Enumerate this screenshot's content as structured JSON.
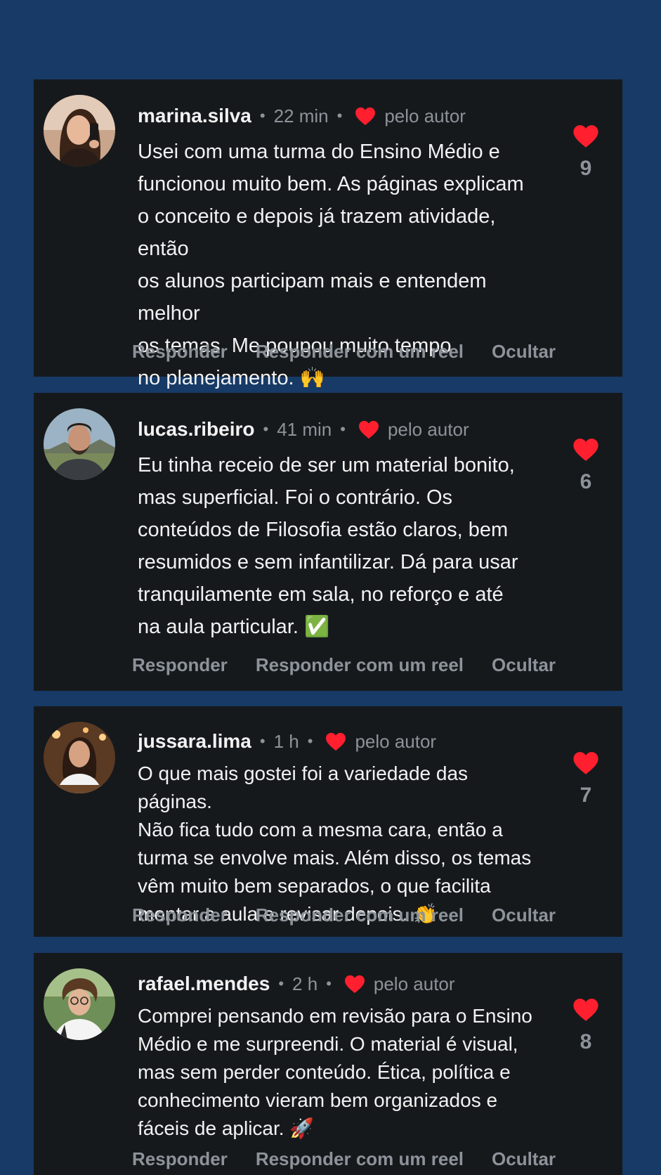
{
  "colors": {
    "background": "#173a66",
    "card": "#16191c",
    "heart": "#ff1f2e",
    "muted": "#8d939a",
    "text": "#f2f2f2"
  },
  "icons": {
    "author_like": "heart-icon",
    "like": "heart-icon"
  },
  "separator": "•",
  "comments": [
    {
      "username": "marina.silva",
      "time": "22 min",
      "liked_by_author": "pelo autor",
      "text": "Usei com uma turma do Ensino Médio e\nfuncionou muito bem. As páginas explicam\no conceito e depois já trazem atividade, então\nos alunos participam mais e entendem melhor\nos temas. Me poupou muito tempo\nno planejamento. 🙌",
      "likes": "9",
      "actions": [
        "Responder",
        "Responder com um reel",
        "Ocultar"
      ]
    },
    {
      "username": "lucas.ribeiro",
      "time": "41 min",
      "liked_by_author": "pelo autor",
      "text": "Eu tinha receio de ser um material bonito,\nmas superficial. Foi o contrário. Os\nconteúdos de Filosofia estão claros, bem\nresumidos e sem infantilizar. Dá para usar\ntranquilamente em sala, no reforço e até\nna aula particular. ✅",
      "likes": "6",
      "actions": [
        "Responder",
        "Responder com um reel",
        "Ocultar"
      ]
    },
    {
      "username": "jussara.lima",
      "time": "1 h",
      "liked_by_author": "pelo autor",
      "text": "O que mais gostei foi a variedade das páginas.\nNão fica tudo com a mesma cara, então a\nturma se envolve mais. Além disso, os temas\nvêm muito bem separados, o que facilita\nmontar a aula e revisar depois. 👏",
      "likes": "7",
      "actions": [
        "Responder",
        "Responder com um reel",
        "Ocultar"
      ]
    },
    {
      "username": "rafael.mendes",
      "time": "2 h",
      "liked_by_author": "pelo autor",
      "text": "Comprei pensando em revisão para o Ensino\nMédio e me surpreendi. O material é visual,\nmas sem perder conteúdo. Ética, política e\nconhecimento vieram bem organizados e\nfáceis de aplicar. 🚀",
      "likes": "8",
      "actions": [
        "Responder",
        "Responder com um reel",
        "Ocultar"
      ]
    }
  ]
}
